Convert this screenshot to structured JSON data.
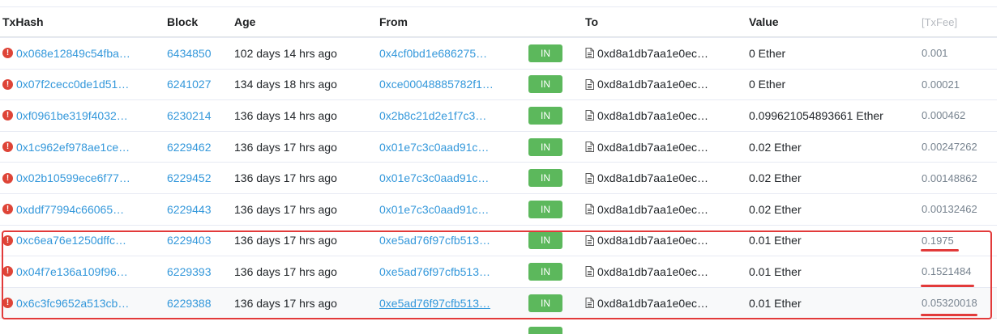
{
  "columns": {
    "txhash": "TxHash",
    "block": "Block",
    "age": "Age",
    "from": "From",
    "to": "To",
    "value": "Value",
    "fee": "[TxFee]"
  },
  "rows": [
    {
      "hash": "0x068e12849c54fba…",
      "block": "6434850",
      "age": "102 days 14 hrs ago",
      "from": "0x4cf0bd1e686275…",
      "direction": "IN",
      "to": "0xd8a1db7aa1e0ec…",
      "value": "0 Ether",
      "fee": "0.001"
    },
    {
      "hash": "0x07f2cecc0de1d51…",
      "block": "6241027",
      "age": "134 days 18 hrs ago",
      "from": "0xce00048885782f1…",
      "direction": "IN",
      "to": "0xd8a1db7aa1e0ec…",
      "value": "0 Ether",
      "fee": "0.00021"
    },
    {
      "hash": "0xf0961be319f4032…",
      "block": "6230214",
      "age": "136 days 14 hrs ago",
      "from": "0x2b8c21d2e1f7c3…",
      "direction": "IN",
      "to": "0xd8a1db7aa1e0ec…",
      "value": "0.099621054893661 Ether",
      "fee": "0.000462"
    },
    {
      "hash": "0x1c962ef978ae1ce…",
      "block": "6229462",
      "age": "136 days 17 hrs ago",
      "from": "0x01e7c3c0aad91c…",
      "direction": "IN",
      "to": "0xd8a1db7aa1e0ec…",
      "value": "0.02 Ether",
      "fee": "0.00247262"
    },
    {
      "hash": "0x02b10599ece6f77…",
      "block": "6229452",
      "age": "136 days 17 hrs ago",
      "from": "0x01e7c3c0aad91c…",
      "direction": "IN",
      "to": "0xd8a1db7aa1e0ec…",
      "value": "0.02 Ether",
      "fee": "0.00148862"
    },
    {
      "hash": "0xddf77994c66065…",
      "block": "6229443",
      "age": "136 days 17 hrs ago",
      "from": "0x01e7c3c0aad91c…",
      "direction": "IN",
      "to": "0xd8a1db7aa1e0ec…",
      "value": "0.02 Ether",
      "fee": "0.00132462"
    },
    {
      "hash": "0xc6ea76e1250dffc…",
      "block": "6229403",
      "age": "136 days 17 hrs ago",
      "from": "0xe5ad76f97cfb513…",
      "direction": "IN",
      "to": "0xd8a1db7aa1e0ec…",
      "value": "0.01 Ether",
      "fee": "0.1975"
    },
    {
      "hash": "0x04f7e136a109f96…",
      "block": "6229393",
      "age": "136 days 17 hrs ago",
      "from": "0xe5ad76f97cfb513…",
      "direction": "IN",
      "to": "0xd8a1db7aa1e0ec…",
      "value": "0.01 Ether",
      "fee": "0.1521484"
    },
    {
      "hash": "0x6c3fc9652a513cb…",
      "block": "6229388",
      "age": "136 days 17 hrs ago",
      "from": "0xe5ad76f97cfb513…",
      "direction": "IN",
      "to": "0xd8a1db7aa1e0ec…",
      "value": "0.01 Ether",
      "fee": "0.05320018"
    }
  ],
  "icons": {
    "error": "exclamation-circle-icon",
    "contract": "document-icon"
  },
  "colors": {
    "link": "#3498db",
    "badge_in": "#5cb85c",
    "error": "#de4437",
    "annotation": "#e23a3a"
  }
}
